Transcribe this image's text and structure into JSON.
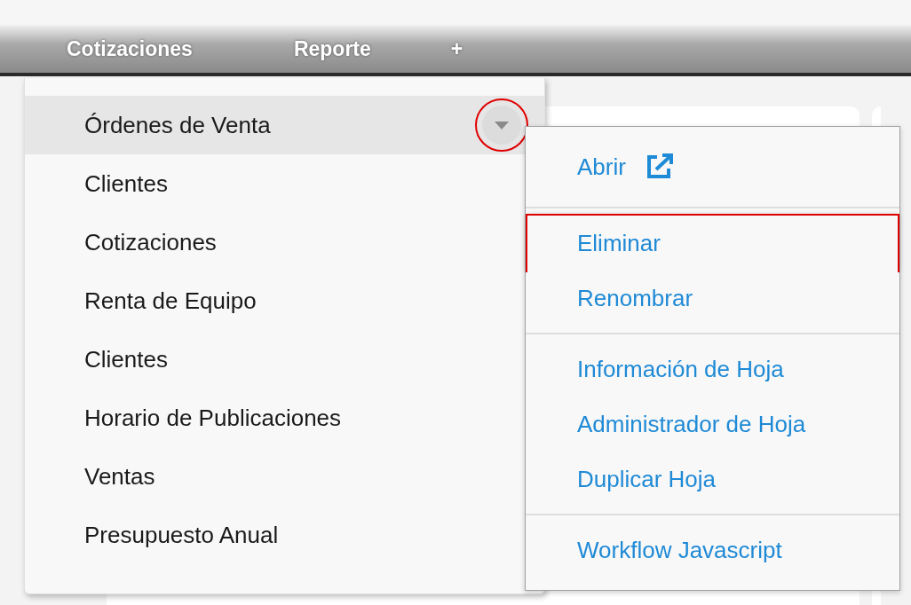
{
  "nav_tabs": [
    {
      "label": "Cotizaciones"
    },
    {
      "label": "Reporte"
    }
  ],
  "add_tab": {
    "label": "+"
  },
  "sheet_list": [
    {
      "label": "Órdenes de Venta",
      "selected": true
    },
    {
      "label": "Clientes",
      "selected": false
    },
    {
      "label": "Cotizaciones",
      "selected": false
    },
    {
      "label": "Renta de Equipo",
      "selected": false
    },
    {
      "label": "Clientes",
      "selected": false
    },
    {
      "label": "Horario de Publicaciones",
      "selected": false
    },
    {
      "label": "Ventas",
      "selected": false
    },
    {
      "label": "Presupuesto Anual",
      "selected": false
    }
  ],
  "row_menu_button": {
    "annotated": true
  },
  "context_menu": [
    [
      {
        "label": "Abrir",
        "kind": "external",
        "annotated": false
      }
    ],
    [
      {
        "label": "Eliminar",
        "kind": "plain",
        "annotated": true
      },
      {
        "label": "Renombrar",
        "kind": "plain",
        "annotated": false
      }
    ],
    [
      {
        "label": "Información de Hoja",
        "kind": "plain",
        "annotated": false
      },
      {
        "label": "Administrador de Hoja",
        "kind": "plain",
        "annotated": false
      },
      {
        "label": "Duplicar Hoja",
        "kind": "plain",
        "annotated": false
      }
    ],
    [
      {
        "label": "Workflow Javascript",
        "kind": "plain",
        "annotated": false
      }
    ]
  ]
}
